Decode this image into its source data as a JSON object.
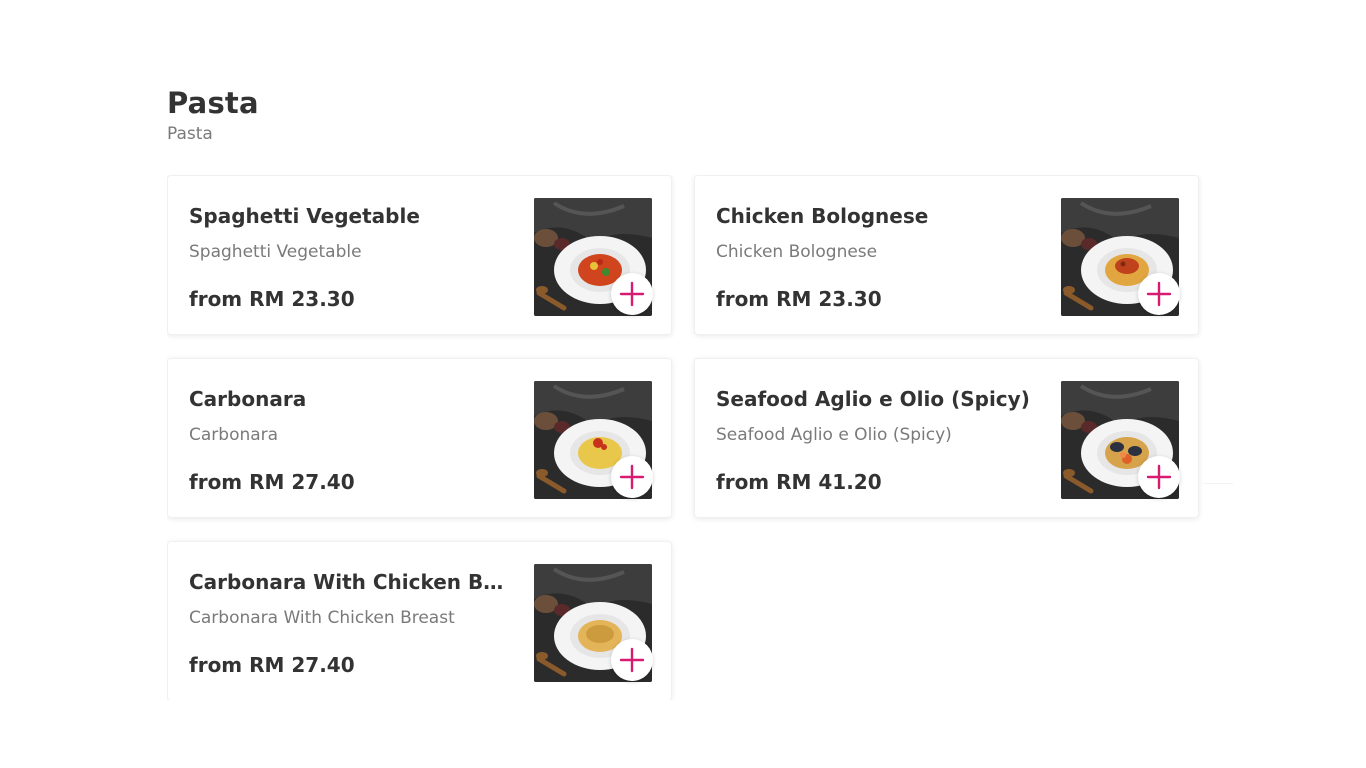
{
  "section": {
    "title": "Pasta",
    "subtitle": "Pasta"
  },
  "colors": {
    "accent": "#d81b72",
    "text_primary": "#333333",
    "text_secondary": "#7a7a7a"
  },
  "items": [
    {
      "name": "Spaghetti Vegetable",
      "description": "Spaghetti Vegetable",
      "price": "from RM 23.30",
      "image_icon": "spaghetti-vegetable-photo",
      "add_icon": "plus-icon"
    },
    {
      "name": "Chicken Bolognese",
      "description": "Chicken Bolognese",
      "price": "from RM 23.30",
      "image_icon": "chicken-bolognese-photo",
      "add_icon": "plus-icon"
    },
    {
      "name": "Carbonara",
      "description": "Carbonara",
      "price": "from RM 27.40",
      "image_icon": "carbonara-photo",
      "add_icon": "plus-icon"
    },
    {
      "name": "Seafood Aglio e Olio (Spicy)",
      "description": "Seafood Aglio e Olio (Spicy)",
      "price": "from RM 41.20",
      "image_icon": "seafood-aglio-olio-photo",
      "add_icon": "plus-icon"
    },
    {
      "name": "Carbonara With Chicken Breast",
      "description": "Carbonara With Chicken Breast",
      "price": "from RM 27.40",
      "image_icon": "carbonara-chicken-photo",
      "add_icon": "plus-icon"
    }
  ]
}
